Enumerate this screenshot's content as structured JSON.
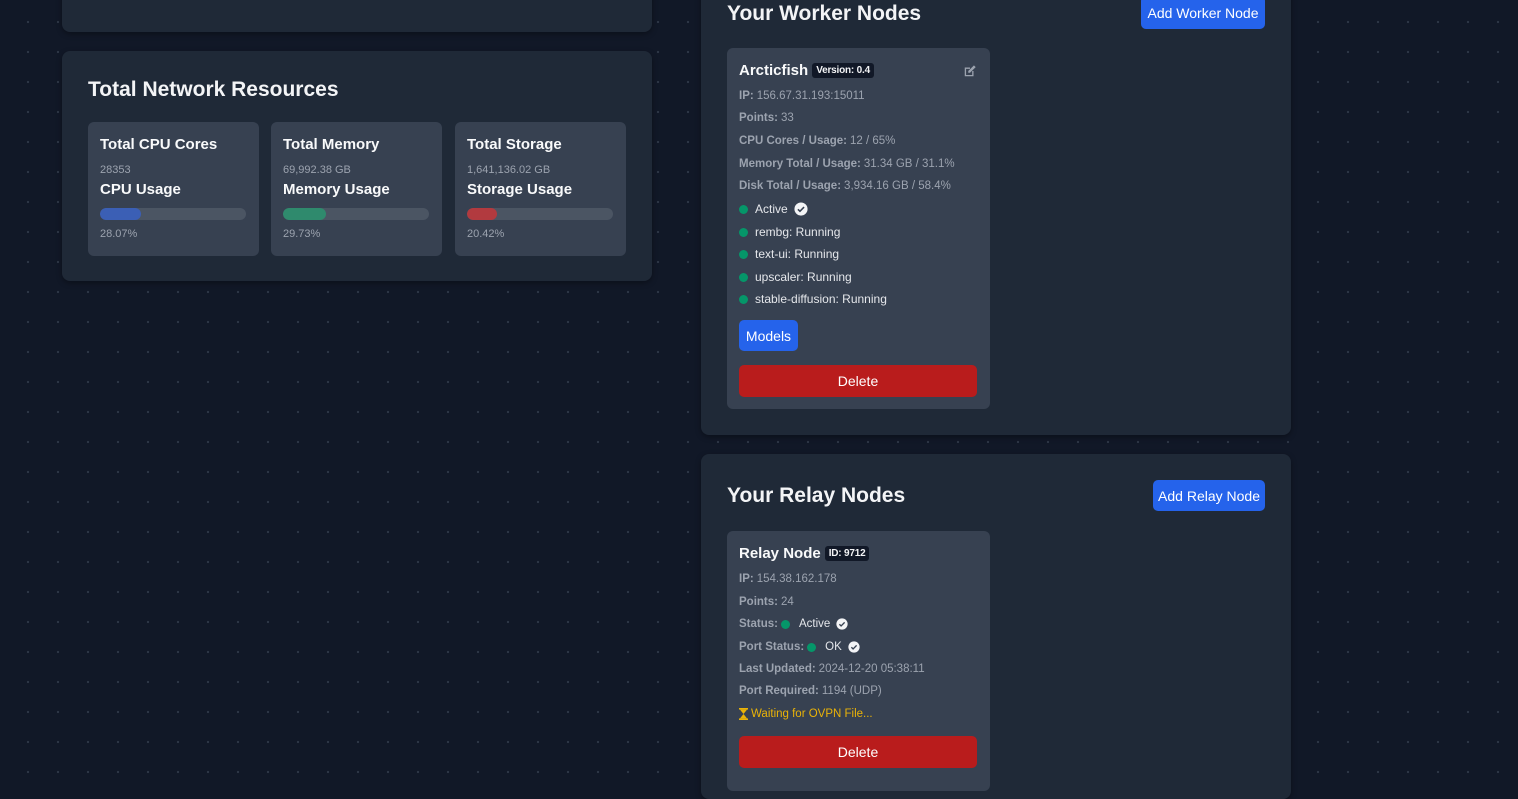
{
  "resources": {
    "title": "Total Network Resources",
    "cards": [
      {
        "title": "Total CPU Cores",
        "value": "28353",
        "usage_label": "CPU Usage",
        "usage_percent": 28.07,
        "percent_text": "28.07%",
        "color": "#3b5fb5"
      },
      {
        "title": "Total Memory",
        "value": "69,992.38 GB",
        "usage_label": "Memory Usage",
        "usage_percent": 29.73,
        "percent_text": "29.73%",
        "color": "#2f8a6d"
      },
      {
        "title": "Total Storage",
        "value": "1,641,136.02 GB",
        "usage_label": "Storage Usage",
        "usage_percent": 20.42,
        "percent_text": "20.42%",
        "color": "#b23a3f"
      }
    ]
  },
  "worker": {
    "title": "Your Worker Nodes",
    "add_label": "Add Worker Node",
    "node": {
      "name": "Arcticfish",
      "badge": "Version: 0.4",
      "info": [
        {
          "label": "IP:",
          "value": "156.67.31.193:15011"
        },
        {
          "label": "Points:",
          "value": "33"
        },
        {
          "label": "CPU Cores / Usage:",
          "value": "12 / 65%"
        },
        {
          "label": "Memory Total / Usage:",
          "value": "31.34 GB / 31.1%"
        },
        {
          "label": "Disk Total / Usage:",
          "value": "3,934.16 GB / 58.4%"
        }
      ],
      "status": "Active",
      "services": [
        "rembg: Running",
        "text-ui: Running",
        "upscaler: Running",
        "stable-diffusion: Running"
      ],
      "models_label": "Models",
      "delete_label": "Delete"
    }
  },
  "relay": {
    "title": "Your Relay Nodes",
    "add_label": "Add Relay Node",
    "node": {
      "name": "Relay Node",
      "badge": "ID: 9712",
      "ip_label": "IP:",
      "ip": "154.38.162.178",
      "points_label": "Points:",
      "points": "24",
      "status_label": "Status:",
      "status": "Active",
      "port_status_label": "Port Status:",
      "port_status": "OK",
      "updated_label": "Last Updated:",
      "updated": "2024-12-20 05:38:11",
      "port_label": "Port Required:",
      "port": "1194 (UDP)",
      "waiting": "Waiting for OVPN File...",
      "delete_label": "Delete"
    }
  },
  "colors": {
    "background": "#111827",
    "panel": "#1f2937",
    "card": "#374151",
    "accent": "#2563eb",
    "danger": "#b91c1c",
    "success": "#059669",
    "warning": "#eab308"
  }
}
